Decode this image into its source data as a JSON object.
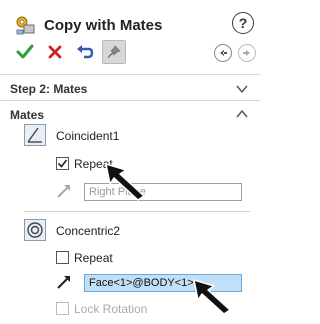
{
  "header": {
    "title": "Copy with Mates",
    "help_symbol": "?"
  },
  "toolbar": {
    "ok_icon": "checkmark-icon",
    "cancel_icon": "x-icon",
    "undo_icon": "undo-icon",
    "pin_icon": "pushpin-icon"
  },
  "colors": {
    "ok": "#2e9e3a",
    "cancel": "#d32020",
    "undo": "#2b5fb0",
    "selection_bg": "#bfe0f7"
  },
  "step": {
    "label": "Step 2: Mates"
  },
  "mates": {
    "label": "Mates",
    "items": [
      {
        "name": "Coincident1",
        "repeat_label": "Repeat",
        "repeat_checked": true,
        "selection_value": "Right Plane"
      },
      {
        "name": "Concentric2",
        "repeat_label": "Repeat",
        "repeat_checked": false,
        "selection_value": "Face<1>@BODY<1>",
        "lock_rotation_label": "Lock Rotation"
      }
    ]
  }
}
